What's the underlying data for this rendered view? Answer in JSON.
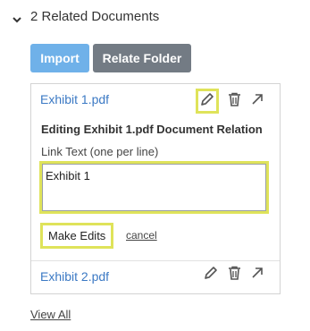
{
  "section": {
    "title": "2 Related Documents"
  },
  "toolbar": {
    "import_label": "Import",
    "relate_folder_label": "Relate Folder"
  },
  "documents": [
    {
      "name": "Exhibit 1.pdf"
    },
    {
      "name": "Exhibit 2.pdf"
    }
  ],
  "edit": {
    "title": "Editing Exhibit 1.pdf Document Relation",
    "link_text_label": "Link Text (one per line)",
    "link_text_value": "Exhibit 1",
    "make_edits_label": "Make Edits",
    "cancel_label": "cancel"
  },
  "footer": {
    "view_all_label": "View All"
  },
  "colors": {
    "link": "#3b79c4",
    "import_button": "#6fb1e9",
    "relate_button": "#737b84",
    "highlight": "#dfe35a"
  },
  "icons": [
    "chevron-down-icon",
    "pencil-icon",
    "trash-icon",
    "external-link-icon"
  ]
}
